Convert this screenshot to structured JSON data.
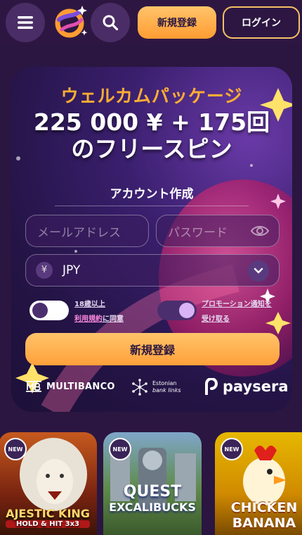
{
  "header": {
    "signup_label": "新規登録",
    "login_label": "ログイン"
  },
  "promo": {
    "welcome": "ウェルカムパッケージ",
    "bonus_line1": "225 000 ¥ + 175回",
    "bonus_line2": "のフリースピン",
    "account_title": "アカウント作成",
    "email_placeholder": "メールアドレス",
    "password_placeholder": "パスワード",
    "currency_symbol": "¥",
    "currency_value": "JPY",
    "age_line1": "18歳以上",
    "terms_link": "利用規約",
    "terms_suffix": "に同意",
    "promo_line1": "プロモーション通知を",
    "promo_line2": "受け取る",
    "signup_button": "新規登録"
  },
  "payments": {
    "multibanco": "MULTIBANCO",
    "estonian_line1": "Estonian",
    "estonian_line2": "bank links",
    "paysera": "paysera"
  },
  "games": [
    {
      "title_line1": "AJESTIC KING",
      "title_line2": "HOLD & HIT 3x3",
      "badge": "NEW"
    },
    {
      "title_line1": "QUEST",
      "title_line2": "EXCALIBUCKS",
      "badge": "NEW"
    },
    {
      "title_line1": "CHICKEN",
      "title_line2": "BANANA",
      "badge": "NEW"
    }
  ],
  "colors": {
    "accent_orange": "#ffae33",
    "button_gradient": "#ffa03a",
    "background": "#2a1640",
    "link_pink": "#ff8be0"
  }
}
